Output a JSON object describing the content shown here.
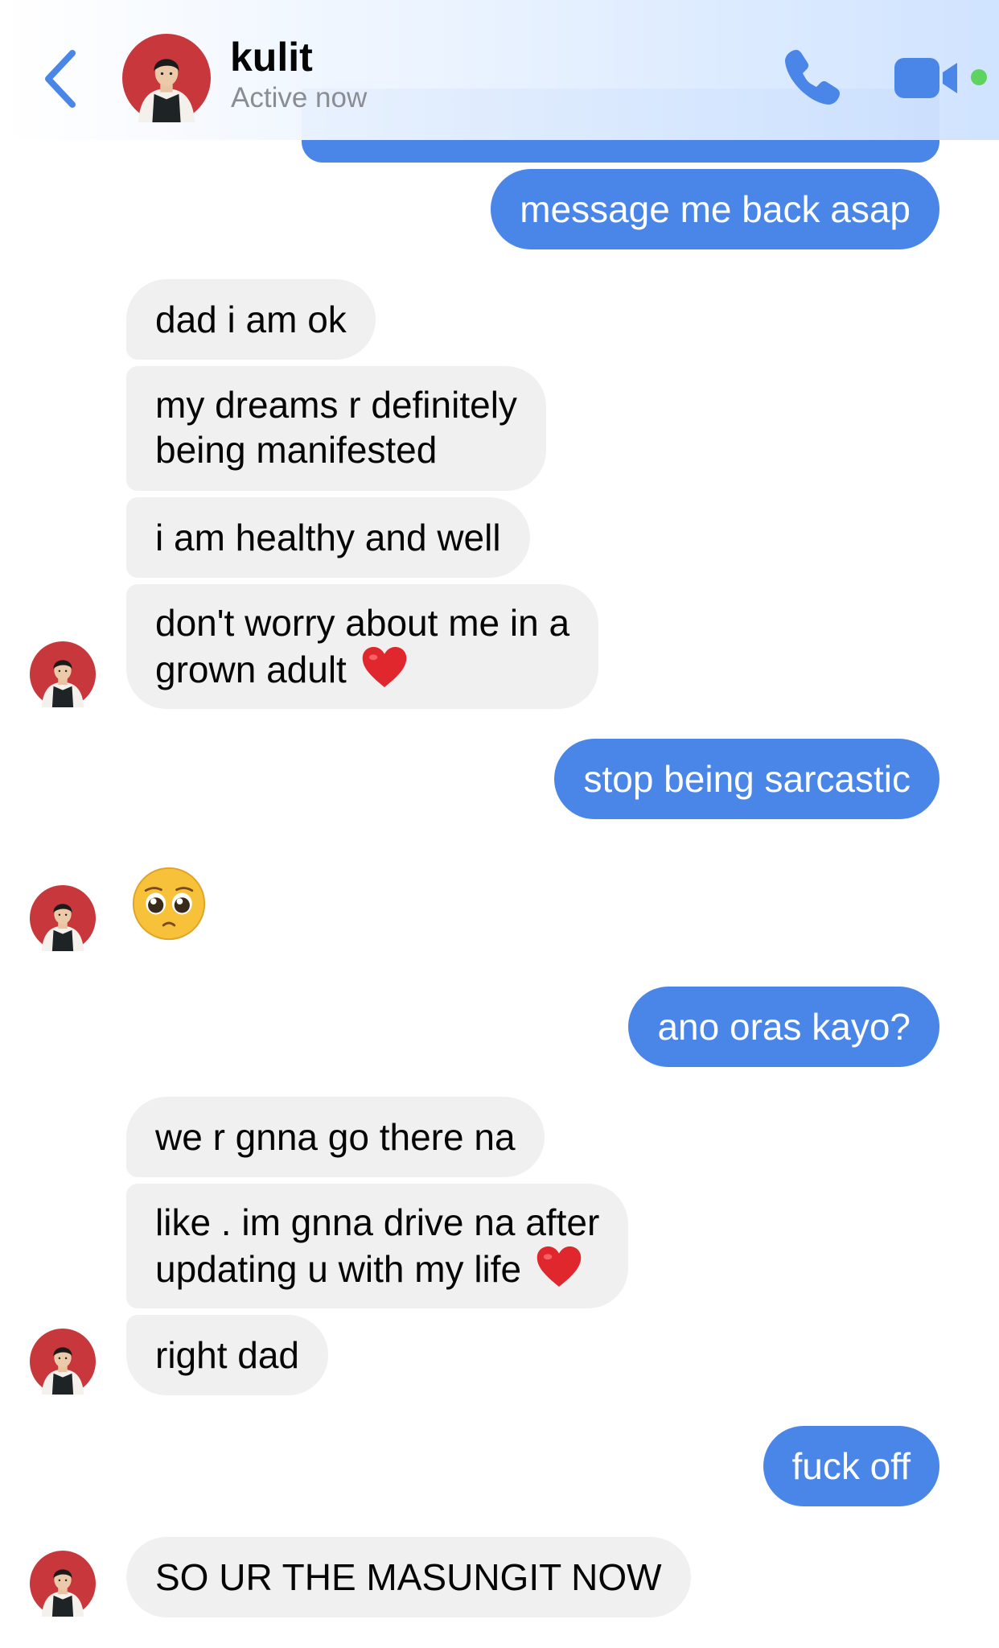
{
  "header": {
    "back_icon": "chevron-left-icon",
    "contact_name": "kulit",
    "status": "Active now",
    "call_icon": "phone-icon",
    "video_icon": "video-camera-icon",
    "accent_color": "#4a86e8",
    "online_color": "#5fd35f"
  },
  "messages": {
    "m1": {
      "from": "me",
      "text": "message me back asap"
    },
    "m2": {
      "from": "them",
      "text": "dad i am ok"
    },
    "m3": {
      "from": "them",
      "line1": "my dreams r definitely",
      "line2": "being manifested"
    },
    "m4": {
      "from": "them",
      "text": "i am healthy and well"
    },
    "m5": {
      "from": "them",
      "line1": "don't worry about me in a",
      "line2": "grown adult",
      "emoji": "red-heart-icon"
    },
    "m6": {
      "from": "me",
      "text": "stop being sarcastic"
    },
    "m7": {
      "from": "them",
      "emoji": "pleading-face-icon"
    },
    "m8": {
      "from": "me",
      "text": "ano oras kayo?"
    },
    "m9": {
      "from": "them",
      "text": "we r gnna go there na"
    },
    "m10": {
      "from": "them",
      "line1": "like . im gnna drive na after",
      "line2": "updating u with my life",
      "emoji": "red-heart-icon"
    },
    "m11": {
      "from": "them",
      "text": "right dad"
    },
    "m12": {
      "from": "me",
      "text": "fuck off"
    },
    "m13": {
      "from": "them",
      "text": "SO UR THE MASUNGIT NOW"
    }
  },
  "colors": {
    "sent_bubble": "#4a86e8",
    "received_bubble": "#f0f0f0",
    "avatar_ring": "#c8373b"
  }
}
